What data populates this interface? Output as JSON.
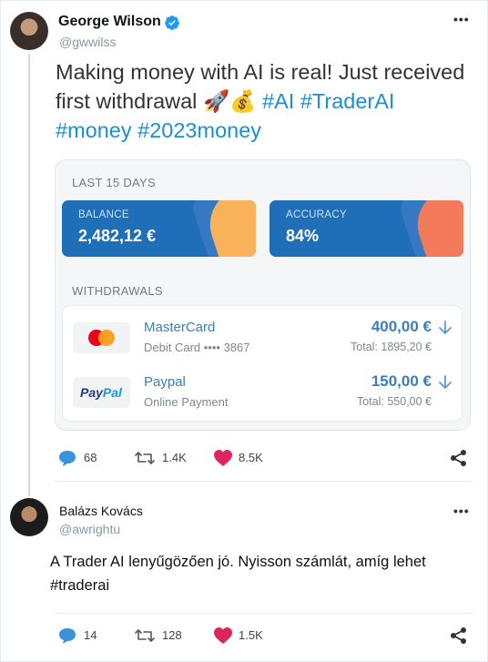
{
  "tweet": {
    "author_name": "George Wilson",
    "author_handle": "@gwwilss",
    "text_plain": "Making money with AI is real! Just received first withdrawal",
    "emoji": "🚀💰",
    "hashtags": [
      "#AI",
      "#TraderAI",
      "#money",
      "#2023money"
    ],
    "actions": {
      "comments": "68",
      "retweets": "1.4K",
      "likes": "8.5K"
    }
  },
  "card": {
    "period_label": "LAST 15 DAYS",
    "balance_label": "BALANCE",
    "balance_value": "2,482,12 €",
    "accuracy_label": "ACCURACY",
    "accuracy_value": "84%",
    "withdrawals_label": "WITHDRAWALS",
    "withdrawals": [
      {
        "name": "MasterCard",
        "sub": "Debit Card  •••• 3867",
        "amount": "400,00 €",
        "total": "Total: 1895,20 €",
        "logo": "mastercard-logo"
      },
      {
        "name": "Paypal",
        "sub": "Online Payment",
        "amount": "150,00 €",
        "total": "Total: 550,00 €",
        "logo": "paypal-logo",
        "logo_text_a": "Pay",
        "logo_text_b": "Pal"
      }
    ]
  },
  "reply": {
    "author_name": "Balázs Kovács",
    "author_handle": "@awrightu",
    "text": "A Trader AI lenyűgözően jó. Nyisson számlát, amíg lehet #traderai",
    "actions": {
      "comments": "14",
      "retweets": "128",
      "likes": "1.5K"
    }
  },
  "colors": {
    "accent_blue": "#1b8fd1",
    "card_blue": "#1f6fb8",
    "balance_deco": "#f9b15a",
    "accuracy_deco": "#f47a5c",
    "like_pink": "#e0245e"
  }
}
